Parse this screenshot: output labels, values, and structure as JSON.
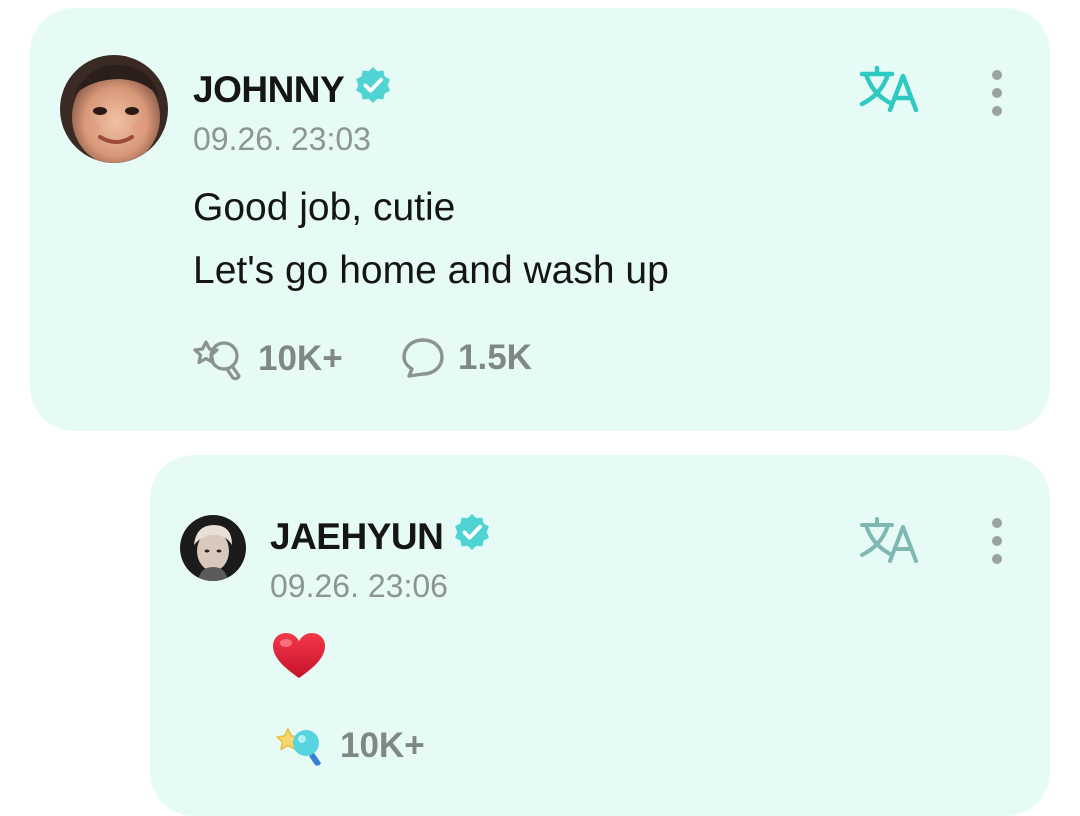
{
  "posts": [
    {
      "author": "JOHNNY",
      "timestamp": "09.26. 23:03",
      "lines": [
        "Good job, cutie",
        "Let's go home and wash up"
      ],
      "reactions": "10K+",
      "comments": "1.5K"
    },
    {
      "author": "JAEHYUN",
      "timestamp": "09.26. 23:06",
      "reactions": "10K+"
    }
  ],
  "colors": {
    "card_bg": "#e6fbf6",
    "accent": "#2ec9c2",
    "verified": "#4fd3d3",
    "heart": "#e8283a",
    "muted_text": "#8c9593"
  },
  "icons": {
    "verified": "verified-badge-icon",
    "translate": "translate-icon",
    "more": "more-vertical-icon",
    "reaction": "reaction-wand-icon",
    "comment": "comment-bubble-icon",
    "heart": "red-heart-emoji"
  }
}
